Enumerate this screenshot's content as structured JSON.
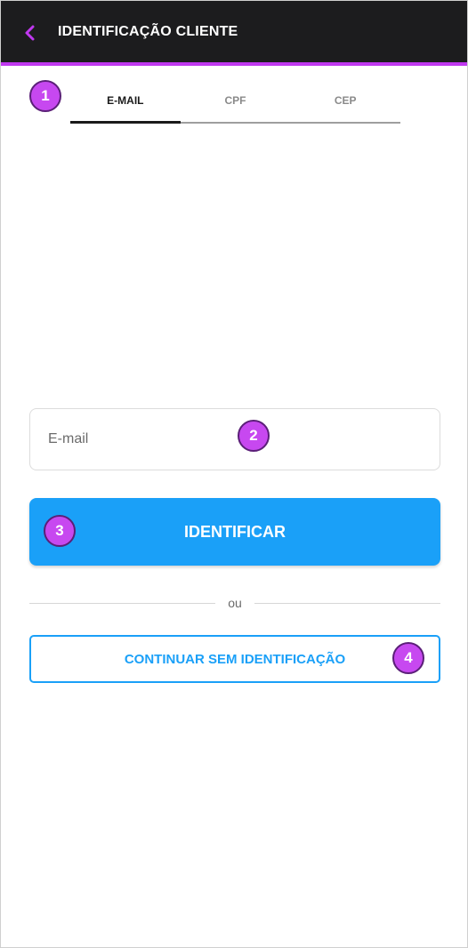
{
  "header": {
    "title": "IDENTIFICAÇÃO CLIENTE",
    "back_icon": "chevron-left-icon",
    "accent_color": "#c038f0",
    "background_color": "#1c1c1e"
  },
  "tabs": [
    {
      "label": "E-MAIL",
      "active": true
    },
    {
      "label": "CPF",
      "active": false
    },
    {
      "label": "CEP",
      "active": false
    }
  ],
  "form": {
    "email_placeholder": "E-mail",
    "email_value": "",
    "identify_label": "IDENTIFICAR",
    "divider_text": "ou",
    "continue_label": "CONTINUAR SEM IDENTIFICAÇÃO",
    "primary_color": "#1aa0f8"
  },
  "annotations": {
    "badge_1": "1",
    "badge_2": "2",
    "badge_3": "3",
    "badge_4": "4",
    "badge_color": "#c748f0"
  }
}
